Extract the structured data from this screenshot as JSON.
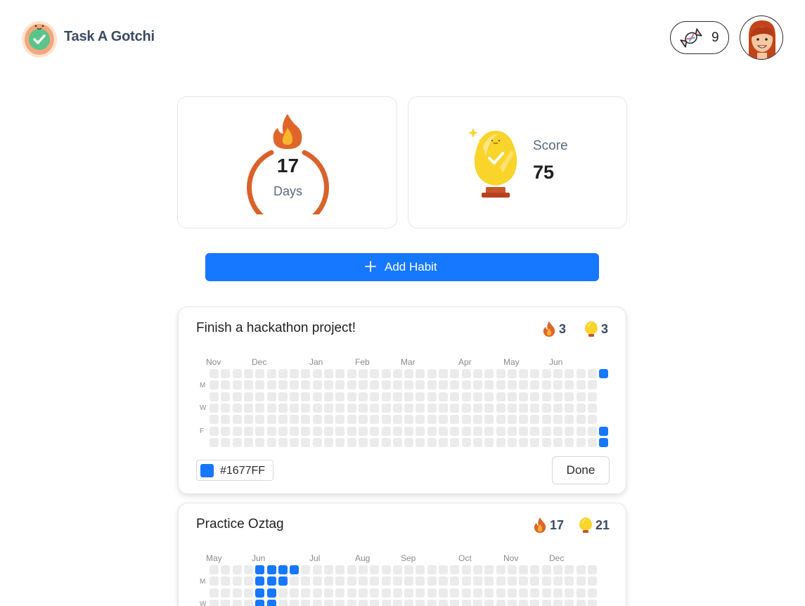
{
  "app": {
    "title": "Task A Gotchi"
  },
  "header": {
    "candy_count": "9"
  },
  "stats": {
    "streak": {
      "value": "17",
      "unit": "Days"
    },
    "score": {
      "label": "Score",
      "value": "75"
    }
  },
  "actions": {
    "add_habit_label": "Add Habit"
  },
  "weekday_labels": [
    "M",
    "W",
    "F"
  ],
  "habits": [
    {
      "title": "Finish a hackathon project!",
      "streak": "3",
      "eggs": "3",
      "months": [
        "Nov",
        "Dec",
        "Jan",
        "Feb",
        "Mar",
        "Apr",
        "May",
        "Jun"
      ],
      "color": "#1677FF",
      "done_label": "Done",
      "completed_days": [
        [
          34,
          0
        ],
        [
          34,
          5
        ],
        [
          34,
          6
        ]
      ]
    },
    {
      "title": "Practice Oztag",
      "streak": "17",
      "eggs": "21",
      "months": [
        "May",
        "Jun",
        "Jul",
        "Aug",
        "Sep",
        "Oct",
        "Nov",
        "Dec"
      ],
      "completed_days": [
        [
          4,
          0
        ],
        [
          5,
          0
        ],
        [
          6,
          0
        ],
        [
          7,
          0
        ],
        [
          4,
          1
        ],
        [
          5,
          1
        ],
        [
          6,
          1
        ],
        [
          4,
          2
        ],
        [
          5,
          2
        ],
        [
          4,
          3
        ],
        [
          5,
          3
        ]
      ]
    }
  ]
}
